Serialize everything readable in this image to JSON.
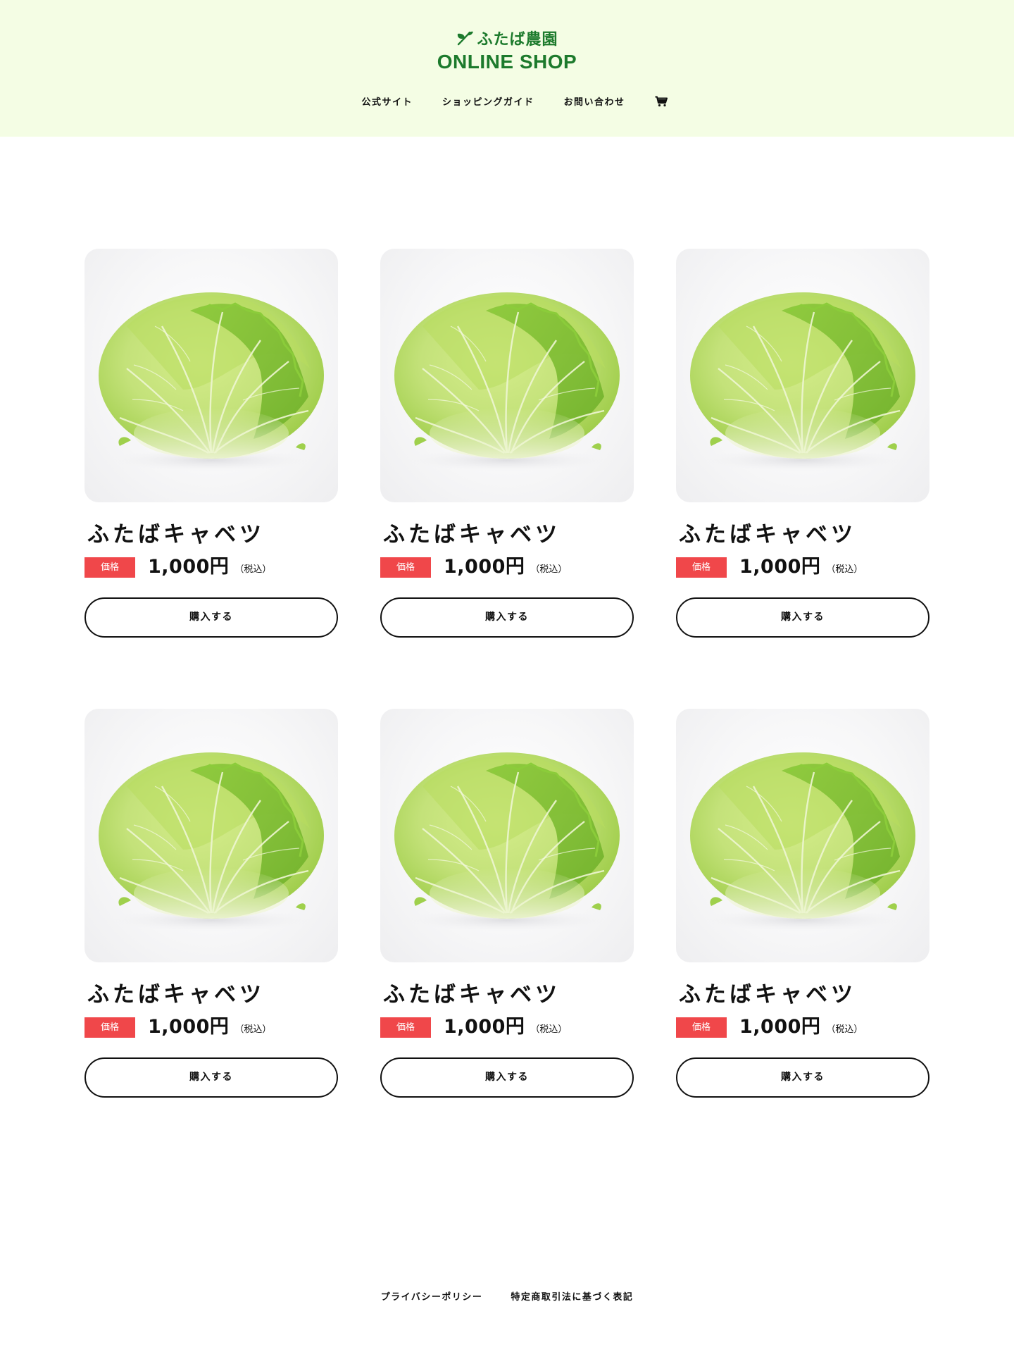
{
  "header": {
    "logo_top": "ふたば農園",
    "logo_bottom": "ONLINE SHOP",
    "brand_color": "#1c7a2c",
    "background_color": "#f4fde4",
    "nav": [
      {
        "label": "公式サイト"
      },
      {
        "label": "ショッピングガイド"
      },
      {
        "label": "お問い合わせ"
      }
    ],
    "cart_icon": "shopping-cart-icon"
  },
  "products": [
    {
      "name": "ふたばキャベツ",
      "price_label": "価格",
      "price": "1,000円",
      "tax": "（税込）",
      "button": "購入する",
      "image": "cabbage"
    },
    {
      "name": "ふたばキャベツ",
      "price_label": "価格",
      "price": "1,000円",
      "tax": "（税込）",
      "button": "購入する",
      "image": "cabbage"
    },
    {
      "name": "ふたばキャベツ",
      "price_label": "価格",
      "price": "1,000円",
      "tax": "（税込）",
      "button": "購入する",
      "image": "cabbage"
    },
    {
      "name": "ふたばキャベツ",
      "price_label": "価格",
      "price": "1,000円",
      "tax": "（税込）",
      "button": "購入する",
      "image": "cabbage"
    },
    {
      "name": "ふたばキャベツ",
      "price_label": "価格",
      "price": "1,000円",
      "tax": "（税込）",
      "button": "購入する",
      "image": "cabbage"
    },
    {
      "name": "ふたばキャベツ",
      "price_label": "価格",
      "price": "1,000円",
      "tax": "（税込）",
      "button": "購入する",
      "image": "cabbage"
    }
  ],
  "price_badge_color": "#f0474a",
  "footer": {
    "links": [
      {
        "label": "プライバシーポリシー"
      },
      {
        "label": "特定商取引法に基づく表記"
      }
    ]
  }
}
